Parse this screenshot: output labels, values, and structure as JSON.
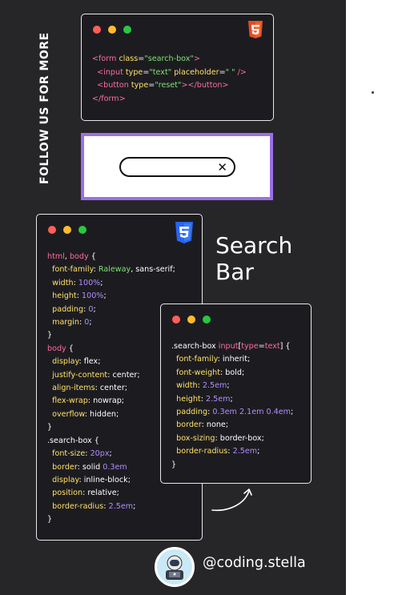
{
  "side_text": "FOLLOW US FOR MORE",
  "html_card": {
    "badge_icon": "html5-icon",
    "lines": [
      {
        "parts": [
          [
            "tag",
            "<form "
          ],
          [
            "attr",
            "class"
          ],
          [
            "plain",
            "="
          ],
          [
            "str",
            "\"search-box\""
          ],
          [
            "tag",
            ">"
          ]
        ]
      },
      {
        "parts": [
          [
            "plain",
            "  "
          ],
          [
            "tag",
            "<input "
          ],
          [
            "attr",
            "type"
          ],
          [
            "plain",
            "="
          ],
          [
            "str",
            "\"text\""
          ],
          [
            "plain",
            " "
          ],
          [
            "attr",
            "placeholder"
          ],
          [
            "plain",
            "="
          ],
          [
            "str",
            "\" \""
          ],
          [
            "plain",
            " "
          ],
          [
            "tag",
            "/>"
          ]
        ]
      },
      {
        "parts": [
          [
            "plain",
            "  "
          ],
          [
            "tag",
            "<button "
          ],
          [
            "attr",
            "type"
          ],
          [
            "plain",
            "="
          ],
          [
            "str",
            "\"reset\""
          ],
          [
            "tag",
            "></button>"
          ]
        ]
      },
      {
        "parts": [
          [
            "tag",
            "</form>"
          ]
        ]
      }
    ]
  },
  "preview": {
    "input_value": "",
    "clear_symbol": "✕"
  },
  "css_card_1": {
    "badge_icon": "css3-icon",
    "lines": [
      {
        "parts": [
          [
            "sel",
            "html"
          ],
          [
            "plain",
            ", "
          ],
          [
            "sel",
            "body"
          ],
          [
            "plain",
            " {"
          ]
        ]
      },
      {
        "parts": [
          [
            "plain",
            "  "
          ],
          [
            "prop",
            "font-family"
          ],
          [
            "plain",
            ": "
          ],
          [
            "valg",
            "Raleway"
          ],
          [
            "plain",
            ", sans-serif;"
          ]
        ]
      },
      {
        "parts": [
          [
            "plain",
            "  "
          ],
          [
            "prop",
            "width"
          ],
          [
            "plain",
            ": "
          ],
          [
            "num",
            "100%"
          ],
          [
            "plain",
            ";"
          ]
        ]
      },
      {
        "parts": [
          [
            "plain",
            "  "
          ],
          [
            "prop",
            "height"
          ],
          [
            "plain",
            ": "
          ],
          [
            "num",
            "100%"
          ],
          [
            "plain",
            ";"
          ]
        ]
      },
      {
        "parts": [
          [
            "plain",
            "  "
          ],
          [
            "prop",
            "padding"
          ],
          [
            "plain",
            ": "
          ],
          [
            "num",
            "0"
          ],
          [
            "plain",
            ";"
          ]
        ]
      },
      {
        "parts": [
          [
            "plain",
            "  "
          ],
          [
            "prop",
            "margin"
          ],
          [
            "plain",
            ": "
          ],
          [
            "num",
            "0"
          ],
          [
            "plain",
            ";"
          ]
        ]
      },
      {
        "parts": [
          [
            "plain",
            "}"
          ]
        ]
      },
      {
        "parts": [
          [
            "sel",
            "body"
          ],
          [
            "plain",
            " {"
          ]
        ]
      },
      {
        "parts": [
          [
            "plain",
            "  "
          ],
          [
            "prop",
            "display"
          ],
          [
            "plain",
            ": flex;"
          ]
        ]
      },
      {
        "parts": [
          [
            "plain",
            "  "
          ],
          [
            "prop",
            "justify-content"
          ],
          [
            "plain",
            ": center;"
          ]
        ]
      },
      {
        "parts": [
          [
            "plain",
            "  "
          ],
          [
            "prop",
            "align-items"
          ],
          [
            "plain",
            ": center;"
          ]
        ]
      },
      {
        "parts": [
          [
            "plain",
            "  "
          ],
          [
            "prop",
            "flex-wrap"
          ],
          [
            "plain",
            ": nowrap;"
          ]
        ]
      },
      {
        "parts": [
          [
            "plain",
            "  "
          ],
          [
            "prop",
            "overflow"
          ],
          [
            "plain",
            ": hidden;"
          ]
        ]
      },
      {
        "parts": [
          [
            "plain",
            "}"
          ]
        ]
      },
      {
        "parts": [
          [
            "plain",
            ".search-box {"
          ]
        ]
      },
      {
        "parts": [
          [
            "plain",
            "  "
          ],
          [
            "prop",
            "font-size"
          ],
          [
            "plain",
            ": "
          ],
          [
            "num",
            "20px"
          ],
          [
            "plain",
            ";"
          ]
        ]
      },
      {
        "parts": [
          [
            "plain",
            "  "
          ],
          [
            "prop",
            "border"
          ],
          [
            "plain",
            ": solid "
          ],
          [
            "num",
            "0.3em"
          ]
        ]
      },
      {
        "parts": [
          [
            "plain",
            "  "
          ],
          [
            "prop",
            "display"
          ],
          [
            "plain",
            ": inline-block;"
          ]
        ]
      },
      {
        "parts": [
          [
            "plain",
            "  "
          ],
          [
            "prop",
            "position"
          ],
          [
            "plain",
            ": relative;"
          ]
        ]
      },
      {
        "parts": [
          [
            "plain",
            "  "
          ],
          [
            "prop",
            "border-radius"
          ],
          [
            "plain",
            ": "
          ],
          [
            "num",
            "2.5em"
          ],
          [
            "plain",
            ";"
          ]
        ]
      },
      {
        "parts": [
          [
            "plain",
            "}"
          ]
        ]
      }
    ]
  },
  "title": {
    "line1": "Search",
    "line2": "Bar"
  },
  "css_card_2": {
    "lines": [
      {
        "parts": [
          [
            "plain",
            ".search-box "
          ],
          [
            "sel",
            "input"
          ],
          [
            "plain",
            "["
          ],
          [
            "sel",
            "type"
          ],
          [
            "plain",
            "="
          ],
          [
            "sel",
            "text"
          ],
          [
            "plain",
            "] {"
          ]
        ]
      },
      {
        "parts": [
          [
            "plain",
            "  "
          ],
          [
            "prop",
            "font-family"
          ],
          [
            "plain",
            ": inherit;"
          ]
        ]
      },
      {
        "parts": [
          [
            "plain",
            "  "
          ],
          [
            "prop",
            "font-weight"
          ],
          [
            "plain",
            ": bold;"
          ]
        ]
      },
      {
        "parts": [
          [
            "plain",
            "  "
          ],
          [
            "prop",
            "width"
          ],
          [
            "plain",
            ": "
          ],
          [
            "num",
            "2.5em"
          ],
          [
            "plain",
            ";"
          ]
        ]
      },
      {
        "parts": [
          [
            "plain",
            "  "
          ],
          [
            "prop",
            "height"
          ],
          [
            "plain",
            ": "
          ],
          [
            "num",
            "2.5em"
          ],
          [
            "plain",
            ";"
          ]
        ]
      },
      {
        "parts": [
          [
            "plain",
            "  "
          ],
          [
            "prop",
            "padding"
          ],
          [
            "plain",
            ": "
          ],
          [
            "num",
            "0.3em 2.1em 0.4em"
          ],
          [
            "plain",
            ";"
          ]
        ]
      },
      {
        "parts": [
          [
            "plain",
            "  "
          ],
          [
            "prop",
            "border"
          ],
          [
            "plain",
            ": none;"
          ]
        ]
      },
      {
        "parts": [
          [
            "plain",
            "  "
          ],
          [
            "prop",
            "box-sizing"
          ],
          [
            "plain",
            ": border-box;"
          ]
        ]
      },
      {
        "parts": [
          [
            "plain",
            "  "
          ],
          [
            "prop",
            "border-radius"
          ],
          [
            "plain",
            ": "
          ],
          [
            "num",
            "2.5em"
          ],
          [
            "plain",
            ";"
          ]
        ]
      },
      {
        "parts": [
          [
            "plain",
            "}"
          ]
        ]
      }
    ]
  },
  "footer": {
    "handle": "@coding.stella",
    "avatar_icon": "astronaut-avatar-icon"
  },
  "colors": {
    "poster_bg": "#262628",
    "card_bg": "#1c1c20",
    "preview_border": "#9b6fe8",
    "html_badge": "#e44d26",
    "css_badge": "#2965f1"
  }
}
